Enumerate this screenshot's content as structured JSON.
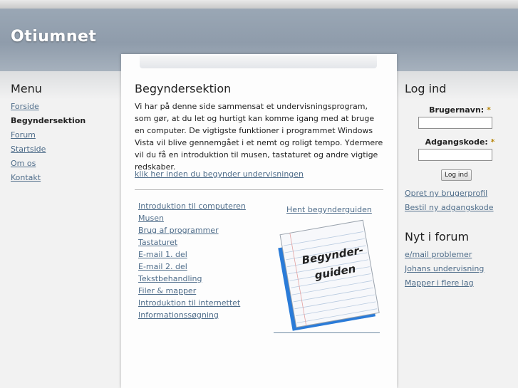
{
  "site": {
    "title": "Otiumnet"
  },
  "menu": {
    "heading": "Menu",
    "items": [
      {
        "label": "Forside"
      },
      {
        "label": "Begyndersektion"
      },
      {
        "label": "Forum"
      },
      {
        "label": "Startside"
      },
      {
        "label": "Om os"
      },
      {
        "label": "Kontakt"
      }
    ],
    "active_index": 1
  },
  "main": {
    "heading": "Begyndersektion",
    "intro": "Vi har på denne side sammensat et undervisningsprogram, som gør, at du let og hurtigt kan komme igang med at bruge en computer. De vigtigste funktioner i programmet Windows Vista vil blive gennemgået i et nemt og roligt tempo. Ydermere vil du få en introduktion til musen, tastaturet og andre vigtige redskaber.",
    "start_link": "klik her inden du begynder undervisningen",
    "lessons": [
      "Introduktion til computeren",
      "Musen",
      "Brug af programmer",
      "Tastaturet",
      "E-mail 1. del",
      "E-mail 2. del",
      "Tekstbehandling",
      "Filer & mapper",
      "Introduktion til internettet",
      "Informationssøgning"
    ],
    "guide_link": "Hent begynderguiden",
    "guide_image_text": [
      "Begynder-",
      "guiden"
    ]
  },
  "login": {
    "heading": "Log ind",
    "username_label": "Brugernavn:",
    "password_label": "Adgangskode:",
    "required_mark": "*",
    "username_value": "",
    "password_value": "",
    "submit_label": "Log ind",
    "links": [
      "Opret ny brugerprofil",
      "Bestil ny adgangskode"
    ]
  },
  "forum": {
    "heading": "Nyt i forum",
    "items": [
      "e/mail problemer",
      "Johans undervisning",
      "Mapper i flere lag"
    ]
  },
  "colors": {
    "link": "#4f6d8a",
    "header": "#9aa7b5",
    "required": "#b8860b"
  }
}
